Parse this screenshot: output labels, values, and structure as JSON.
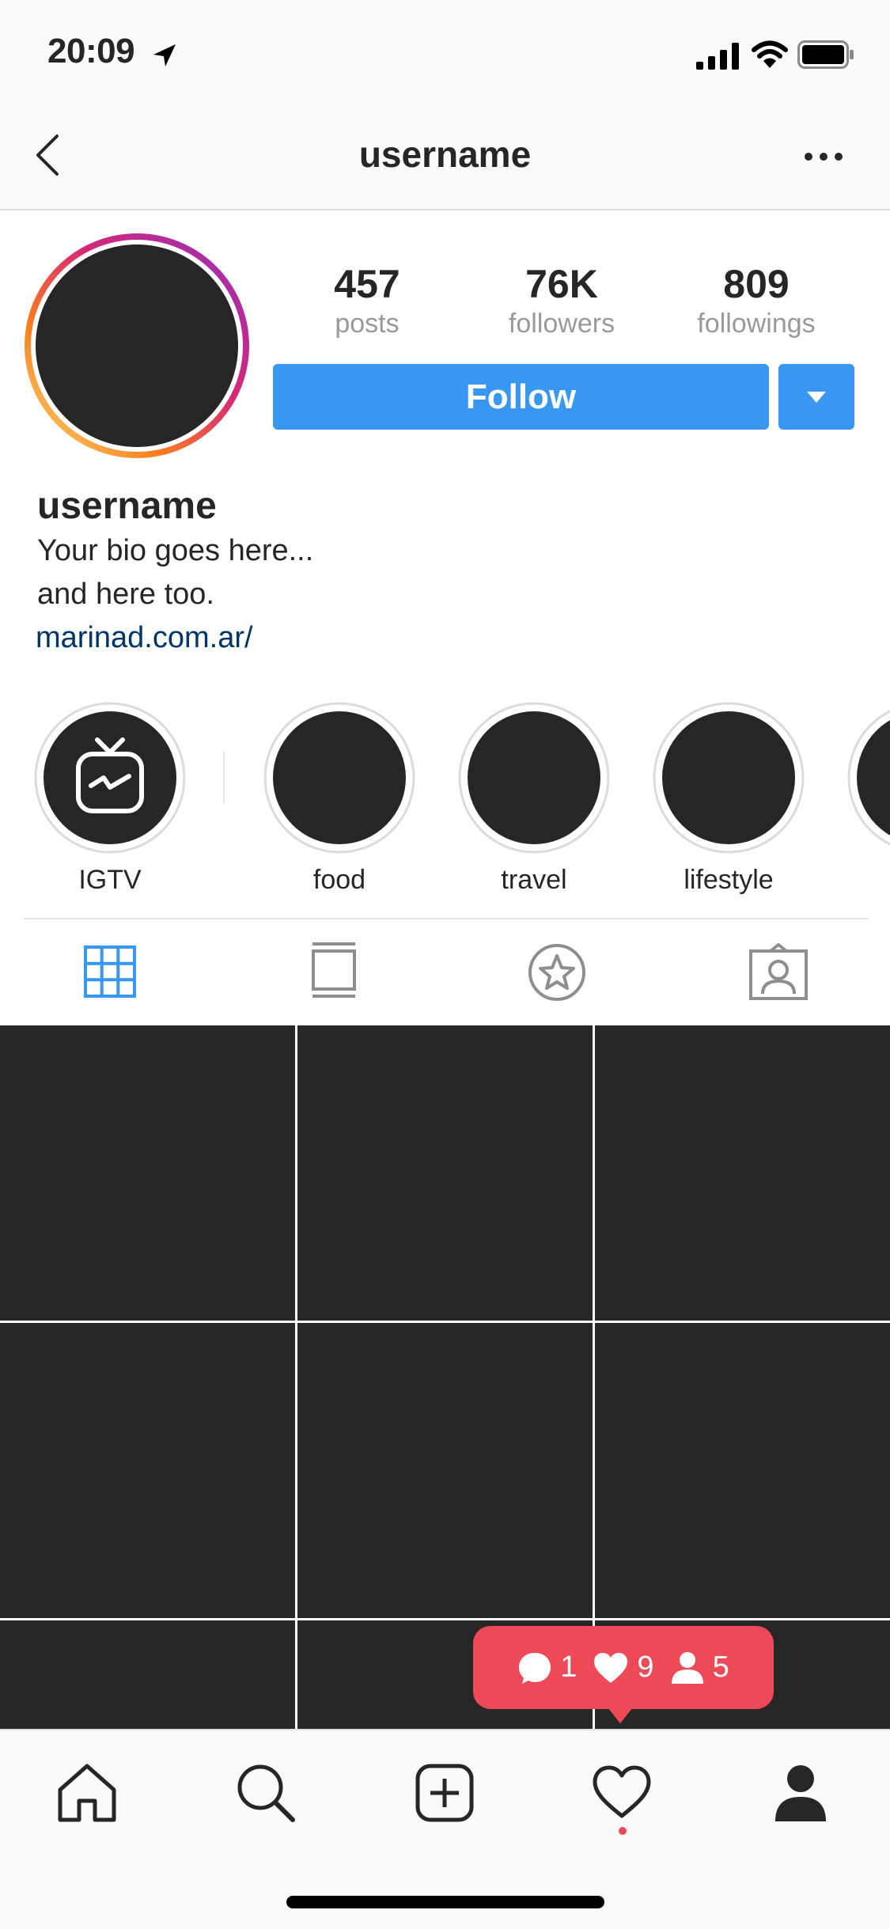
{
  "status_bar": {
    "time": "20:09"
  },
  "header": {
    "title": "username"
  },
  "profile": {
    "stats": [
      {
        "number": "457",
        "label": "posts"
      },
      {
        "number": "76K",
        "label": "followers"
      },
      {
        "number": "809",
        "label": "followings"
      }
    ],
    "follow_label": "Follow",
    "name": "username",
    "bio_lines": [
      "Your bio goes here...",
      "and here too."
    ],
    "link": "marinad.com.ar/"
  },
  "highlights": [
    {
      "label": "IGTV",
      "icon": "igtv-icon"
    },
    {
      "label": "food"
    },
    {
      "label": "travel"
    },
    {
      "label": "lifestyle"
    }
  ],
  "tabs": [
    {
      "icon": "grid-icon",
      "active": true
    },
    {
      "icon": "feed-icon",
      "active": false
    },
    {
      "icon": "star-icon",
      "active": false
    },
    {
      "icon": "tagged-icon",
      "active": false
    }
  ],
  "notification_toast": {
    "comments": "1",
    "likes": "9",
    "follows": "5"
  },
  "bottom_tabs": [
    "home-icon",
    "search-icon",
    "add-icon",
    "heart-icon",
    "profile-icon"
  ],
  "colors": {
    "accent_blue": "#3897f0",
    "toast_red": "#ed4956",
    "link_blue": "#003569",
    "dark": "#262626"
  }
}
